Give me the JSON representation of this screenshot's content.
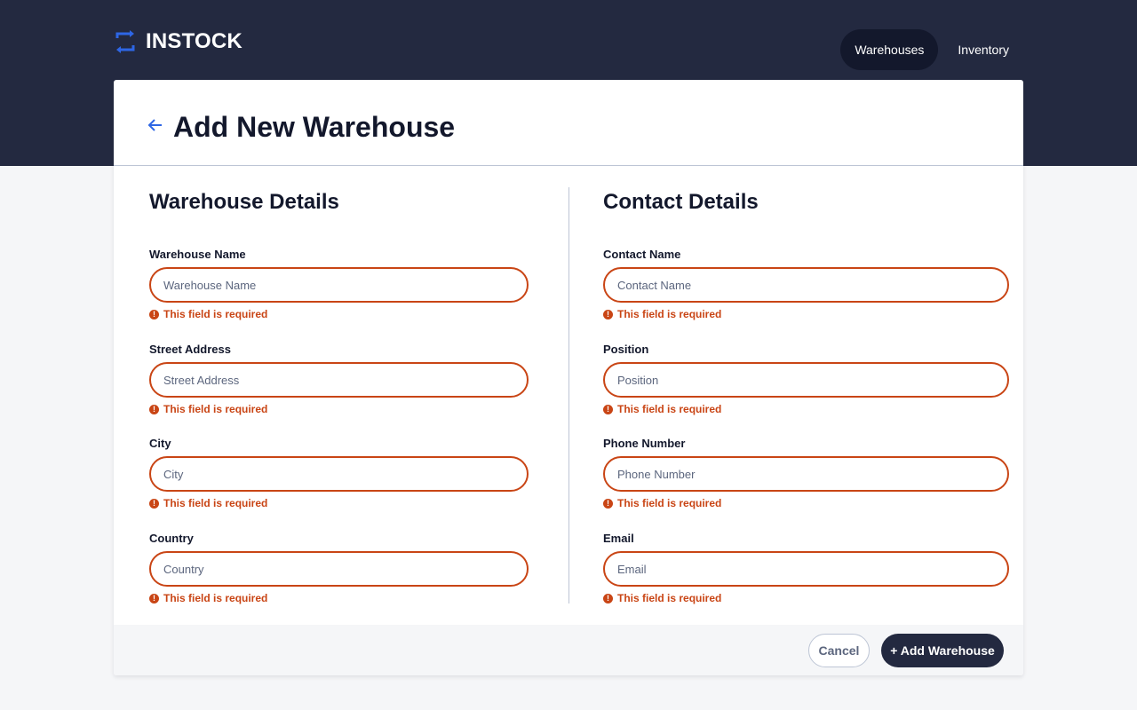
{
  "app": {
    "name": "INSTOCK"
  },
  "nav": {
    "items": [
      {
        "label": "Warehouses",
        "active": true
      },
      {
        "label": "Inventory",
        "active": false
      }
    ]
  },
  "page": {
    "title": "Add New Warehouse"
  },
  "warehouse_details": {
    "title": "Warehouse Details",
    "fields": [
      {
        "label": "Warehouse Name",
        "placeholder": "Warehouse Name",
        "value": "",
        "error": "This field is required"
      },
      {
        "label": "Street Address",
        "placeholder": "Street Address",
        "value": "",
        "error": "This field is required"
      },
      {
        "label": "City",
        "placeholder": "City",
        "value": "",
        "error": "This field is required"
      },
      {
        "label": "Country",
        "placeholder": "Country",
        "value": "",
        "error": "This field is required"
      }
    ]
  },
  "contact_details": {
    "title": "Contact Details",
    "fields": [
      {
        "label": "Contact Name",
        "placeholder": "Contact Name",
        "value": "",
        "error": "This field is required"
      },
      {
        "label": "Position",
        "placeholder": "Position",
        "value": "",
        "error": "This field is required"
      },
      {
        "label": "Phone Number",
        "placeholder": "Phone Number",
        "value": "",
        "error": "This field is required"
      },
      {
        "label": "Email",
        "placeholder": "Email",
        "value": "",
        "error": "This field is required"
      }
    ]
  },
  "footer": {
    "cancel_label": "Cancel",
    "submit_label": "+ Add Warehouse"
  },
  "colors": {
    "header_bg": "#232940",
    "dark": "#13182C",
    "accent": "#2E66E5",
    "error": "#C94515",
    "border": "#BDC5D5",
    "muted": "#5C667E",
    "background": "#F5F6F8"
  },
  "icons": {
    "logo": "swap-arrows-icon",
    "back": "arrow-back-icon",
    "error": "error-icon"
  }
}
